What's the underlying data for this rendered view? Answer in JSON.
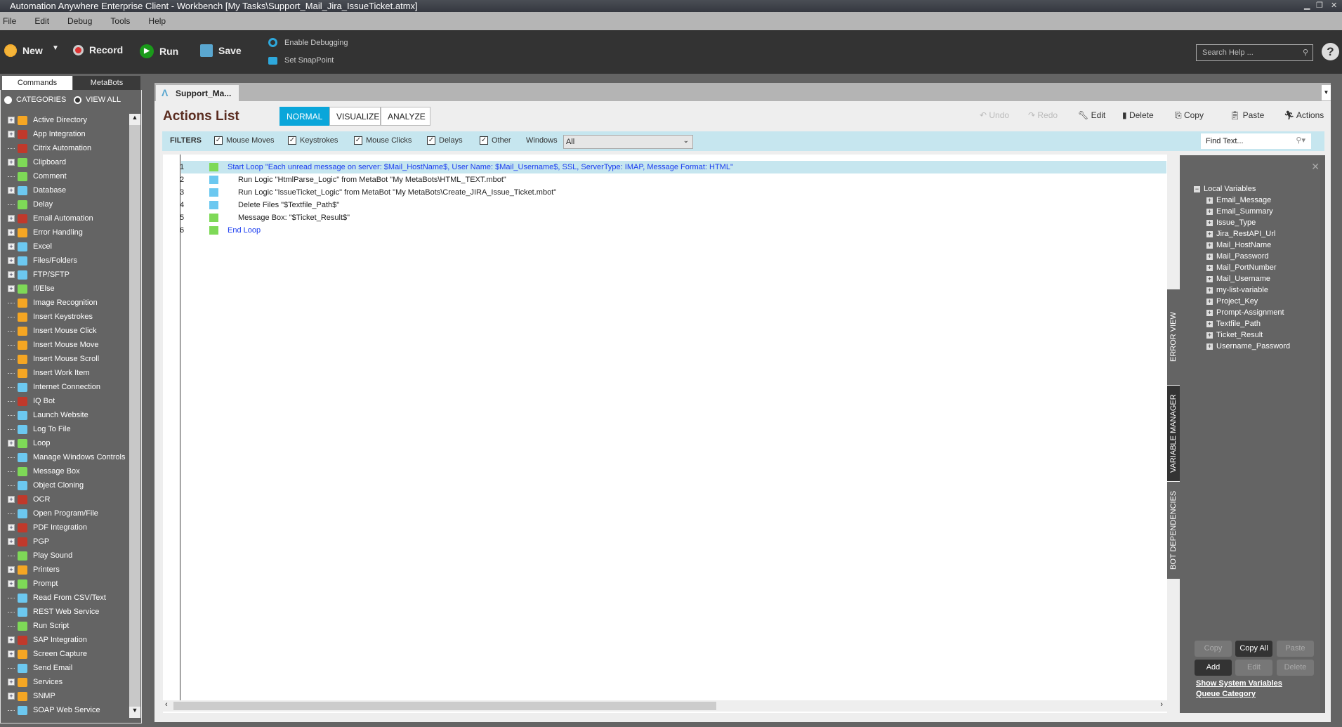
{
  "window": {
    "title": "Automation Anywhere Enterprise Client - Workbench [My Tasks\\Support_Mail_Jira_IssueTicket.atmx]"
  },
  "menu": [
    "File",
    "Edit",
    "Debug",
    "Tools",
    "Help"
  ],
  "toolbar": {
    "new": "New",
    "record": "Record",
    "run": "Run",
    "save": "Save",
    "enable_debugging": "Enable Debugging",
    "set_snappoint": "Set SnapPoint",
    "search_placeholder": "Search Help ...",
    "help": "?"
  },
  "sidebar": {
    "tabs": [
      "Commands",
      "MetaBots"
    ],
    "radio": [
      "CATEGORIES",
      "VIEW ALL"
    ],
    "items": [
      {
        "label": "Active Directory",
        "exp": true,
        "color": "#f5a623"
      },
      {
        "label": "App Integration",
        "exp": true,
        "color": "#c0392b"
      },
      {
        "label": "Citrix Automation",
        "exp": false,
        "color": "#c0392b"
      },
      {
        "label": "Clipboard",
        "exp": true,
        "color": "#7ed957"
      },
      {
        "label": "Comment",
        "exp": false,
        "color": "#7ed957"
      },
      {
        "label": "Database",
        "exp": true,
        "color": "#6cc8f0"
      },
      {
        "label": "Delay",
        "exp": false,
        "color": "#7ed957"
      },
      {
        "label": "Email Automation",
        "exp": true,
        "color": "#c0392b"
      },
      {
        "label": "Error Handling",
        "exp": true,
        "color": "#f5a623"
      },
      {
        "label": "Excel",
        "exp": true,
        "color": "#6cc8f0"
      },
      {
        "label": "Files/Folders",
        "exp": true,
        "color": "#6cc8f0"
      },
      {
        "label": "FTP/SFTP",
        "exp": true,
        "color": "#6cc8f0"
      },
      {
        "label": "If/Else",
        "exp": true,
        "color": "#7ed957"
      },
      {
        "label": "Image Recognition",
        "exp": false,
        "color": "#f5a623"
      },
      {
        "label": "Insert Keystrokes",
        "exp": false,
        "color": "#f5a623"
      },
      {
        "label": "Insert Mouse Click",
        "exp": false,
        "color": "#f5a623"
      },
      {
        "label": "Insert Mouse Move",
        "exp": false,
        "color": "#f5a623"
      },
      {
        "label": "Insert Mouse Scroll",
        "exp": false,
        "color": "#f5a623"
      },
      {
        "label": "Insert Work Item",
        "exp": false,
        "color": "#f5a623"
      },
      {
        "label": "Internet Connection",
        "exp": false,
        "color": "#6cc8f0"
      },
      {
        "label": "IQ Bot",
        "exp": false,
        "color": "#c0392b"
      },
      {
        "label": "Launch Website",
        "exp": false,
        "color": "#6cc8f0"
      },
      {
        "label": "Log To File",
        "exp": false,
        "color": "#6cc8f0"
      },
      {
        "label": "Loop",
        "exp": true,
        "color": "#7ed957"
      },
      {
        "label": "Manage Windows Controls",
        "exp": false,
        "color": "#6cc8f0"
      },
      {
        "label": "Message Box",
        "exp": false,
        "color": "#7ed957"
      },
      {
        "label": "Object Cloning",
        "exp": false,
        "color": "#6cc8f0"
      },
      {
        "label": "OCR",
        "exp": true,
        "color": "#c0392b"
      },
      {
        "label": "Open Program/File",
        "exp": false,
        "color": "#6cc8f0"
      },
      {
        "label": "PDF Integration",
        "exp": true,
        "color": "#c0392b"
      },
      {
        "label": "PGP",
        "exp": true,
        "color": "#c0392b"
      },
      {
        "label": "Play Sound",
        "exp": false,
        "color": "#7ed957"
      },
      {
        "label": "Printers",
        "exp": true,
        "color": "#f5a623"
      },
      {
        "label": "Prompt",
        "exp": true,
        "color": "#7ed957"
      },
      {
        "label": "Read From CSV/Text",
        "exp": false,
        "color": "#6cc8f0"
      },
      {
        "label": "REST Web Service",
        "exp": false,
        "color": "#6cc8f0"
      },
      {
        "label": "Run Script",
        "exp": false,
        "color": "#7ed957"
      },
      {
        "label": "SAP Integration",
        "exp": true,
        "color": "#c0392b"
      },
      {
        "label": "Screen Capture",
        "exp": true,
        "color": "#f5a623"
      },
      {
        "label": "Send Email",
        "exp": false,
        "color": "#6cc8f0"
      },
      {
        "label": "Services",
        "exp": true,
        "color": "#f5a623"
      },
      {
        "label": "SNMP",
        "exp": true,
        "color": "#f5a623"
      },
      {
        "label": "SOAP Web Service",
        "exp": false,
        "color": "#6cc8f0"
      }
    ]
  },
  "doc_tab": "Support_Ma...",
  "main": {
    "title": "Actions List",
    "modes": [
      "NORMAL",
      "VISUALIZE",
      "ANALYZE"
    ],
    "actions": {
      "undo": "Undo",
      "redo": "Redo",
      "edit": "Edit",
      "delete": "Delete",
      "copy": "Copy",
      "paste": "Paste",
      "actions": "Actions"
    },
    "filters": {
      "label": "FILTERS",
      "items": [
        "Mouse Moves",
        "Keystrokes",
        "Mouse Clicks",
        "Delays",
        "Other"
      ],
      "windows_label": "Windows",
      "windows_value": "All",
      "find_placeholder": "Find Text..."
    },
    "rows": [
      {
        "n": "1",
        "text": "Start Loop \"Each unread message on server: $Mail_HostName$, User Name: $Mail_Username$, SSL,  ServerType: IMAP, Message Format: HTML\"",
        "color": "#1a3cf0",
        "indent": false,
        "icon": "#7ed957"
      },
      {
        "n": "2",
        "text": "Run Logic \"HtmlParse_Logic\" from MetaBot \"My MetaBots\\HTML_TEXT.mbot\"",
        "color": "#222",
        "indent": true,
        "icon": "#6cc8f0"
      },
      {
        "n": "3",
        "text": "Run Logic \"IssueTicket_Logic\" from MetaBot \"My MetaBots\\Create_JIRA_Issue_Ticket.mbot\"",
        "color": "#222",
        "indent": true,
        "icon": "#6cc8f0"
      },
      {
        "n": "4",
        "text": "Delete Files \"$Textfile_Path$\"",
        "color": "#222",
        "indent": true,
        "icon": "#6cc8f0"
      },
      {
        "n": "5",
        "text": "Message Box: \"$Ticket_Result$\"",
        "color": "#222",
        "indent": true,
        "icon": "#7ed957"
      },
      {
        "n": "6",
        "text": "End Loop",
        "color": "#1a3cf0",
        "indent": false,
        "icon": "#7ed957"
      }
    ]
  },
  "side_tabs": [
    "ERROR VIEW",
    "VARIABLE MANAGER",
    "BOT DEPENDENCIES"
  ],
  "variables": {
    "root": "Local Variables",
    "items": [
      "Email_Message",
      "Email_Summary",
      "Issue_Type",
      "Jira_RestAPI_Url",
      "Mail_HostName",
      "Mail_Password",
      "Mail_PortNumber",
      "Mail_Username",
      "my-list-variable",
      "Project_Key",
      "Prompt-Assignment",
      "Textfile_Path",
      "Ticket_Result",
      "Username_Password"
    ],
    "buttons": [
      "Copy",
      "Copy All",
      "Paste",
      "Add",
      "Edit",
      "Delete"
    ],
    "show_system": "Show System Variables",
    "queue_category": "Queue Category"
  }
}
